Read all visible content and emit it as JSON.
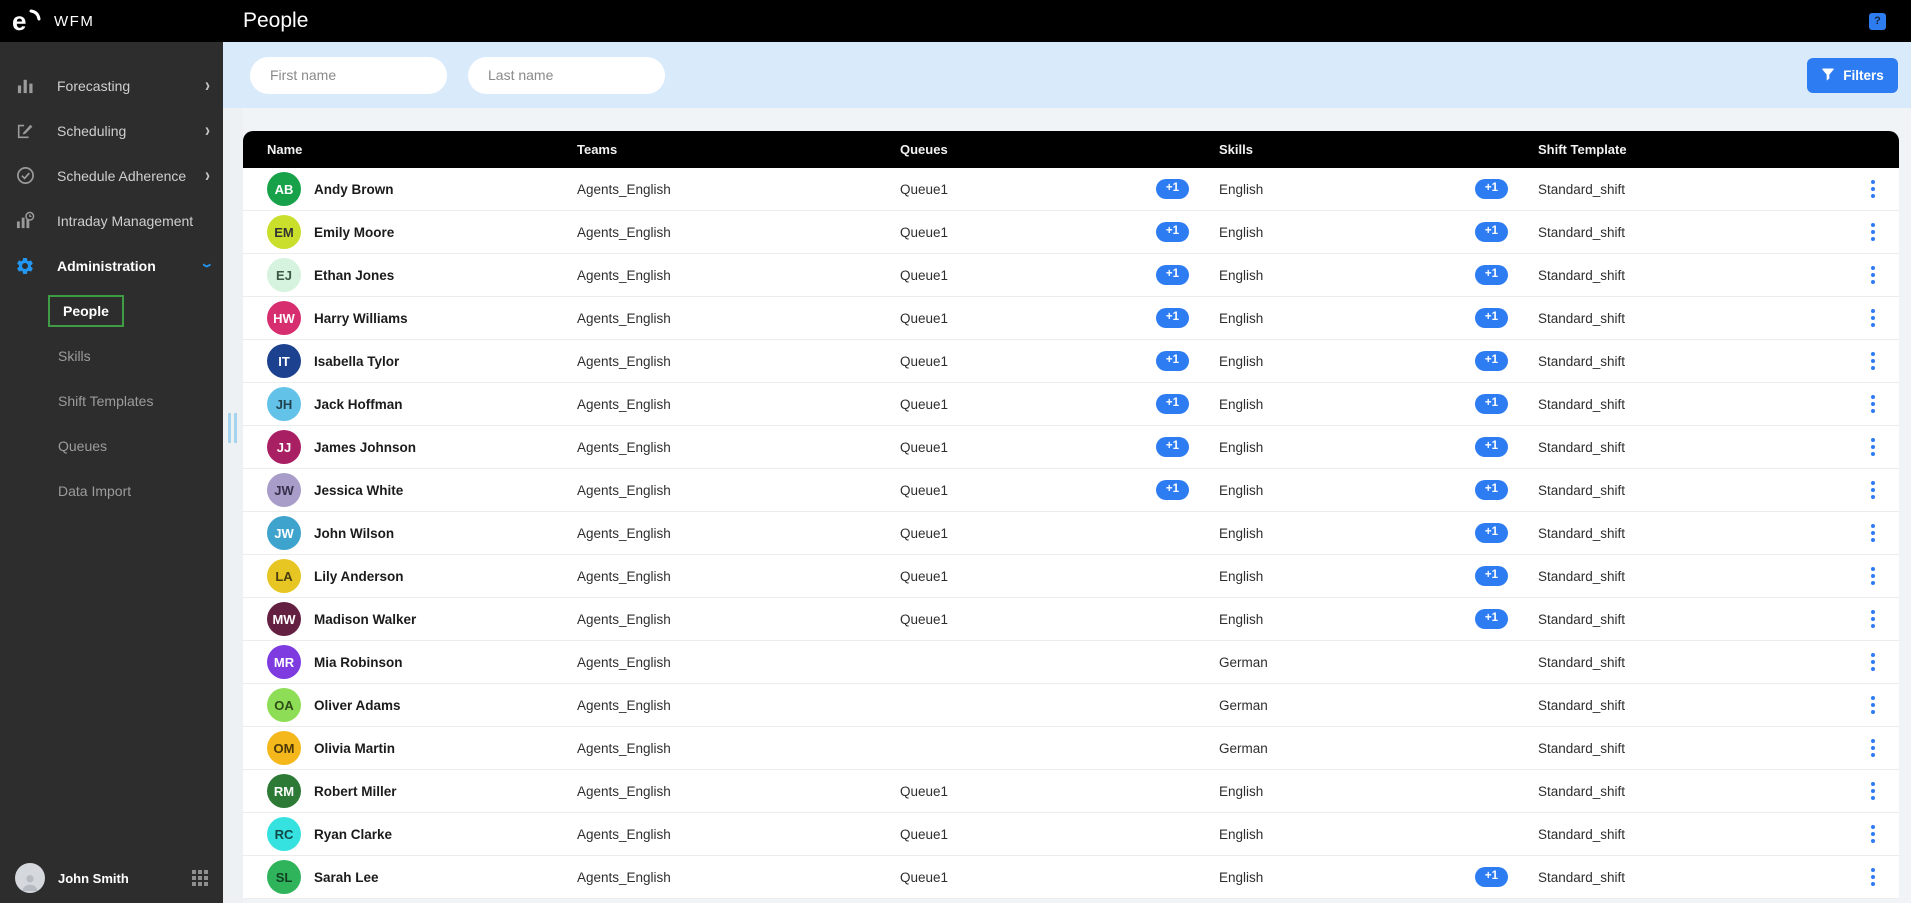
{
  "app": {
    "brand": "WFM",
    "page_title": "People",
    "help_label": "?"
  },
  "sidebar": {
    "items": [
      {
        "label": "Forecasting",
        "icon": "bar-chart-icon",
        "chevron": "right"
      },
      {
        "label": "Scheduling",
        "icon": "edit-icon",
        "chevron": "right"
      },
      {
        "label": "Schedule Adherence",
        "icon": "check-circle-icon",
        "chevron": "right"
      },
      {
        "label": "Intraday Management",
        "icon": "intraday-chart-icon",
        "chevron": ""
      },
      {
        "label": "Administration",
        "icon": "gear-icon",
        "chevron": "down",
        "active": true
      }
    ],
    "admin_children": [
      {
        "label": "People",
        "selected": true
      },
      {
        "label": "Skills",
        "selected": false
      },
      {
        "label": "Shift Templates",
        "selected": false
      },
      {
        "label": "Queues",
        "selected": false
      },
      {
        "label": "Data Import",
        "selected": false
      }
    ],
    "user": {
      "name": "John Smith"
    }
  },
  "filters": {
    "first_name_placeholder": "First name",
    "last_name_placeholder": "Last name",
    "filters_button_label": "Filters"
  },
  "colors": {
    "accent_blue": "#2e7cf2",
    "sidebar_selected_green": "#3f9c44",
    "filterbar_background": "#d9eafb",
    "table_header_background": "#000000",
    "gear_icon_blue": "#2196f3"
  },
  "table": {
    "columns": [
      "Name",
      "Teams",
      "Queues",
      "Skills",
      "Shift Template"
    ],
    "rows": [
      {
        "initials": "AB",
        "avatar_bg": "#17a24a",
        "avatar_fg": "#ffffff",
        "name": "Andy Brown",
        "team": "Agents_English",
        "queue": "Queue1",
        "queue_badge": "+1",
        "skill": "English",
        "skill_badge": "+1",
        "shift": "Standard_shift"
      },
      {
        "initials": "EM",
        "avatar_bg": "#c9df2b",
        "avatar_fg": "#333333",
        "name": "Emily Moore",
        "team": "Agents_English",
        "queue": "Queue1",
        "queue_badge": "+1",
        "skill": "English",
        "skill_badge": "+1",
        "shift": "Standard_shift"
      },
      {
        "initials": "EJ",
        "avatar_bg": "#d5f3de",
        "avatar_fg": "#3c5a44",
        "name": "Ethan Jones",
        "team": "Agents_English",
        "queue": "Queue1",
        "queue_badge": "+1",
        "skill": "English",
        "skill_badge": "+1",
        "shift": "Standard_shift"
      },
      {
        "initials": "HW",
        "avatar_bg": "#d62e6e",
        "avatar_fg": "#ffffff",
        "name": "Harry Williams",
        "team": "Agents_English",
        "queue": "Queue1",
        "queue_badge": "+1",
        "skill": "English",
        "skill_badge": "+1",
        "shift": "Standard_shift"
      },
      {
        "initials": "IT",
        "avatar_bg": "#1c418f",
        "avatar_fg": "#ffffff",
        "name": "Isabella Tylor",
        "team": "Agents_English",
        "queue": "Queue1",
        "queue_badge": "+1",
        "skill": "English",
        "skill_badge": "+1",
        "shift": "Standard_shift"
      },
      {
        "initials": "JH",
        "avatar_bg": "#63c2e8",
        "avatar_fg": "#21424f",
        "name": "Jack Hoffman",
        "team": "Agents_English",
        "queue": "Queue1",
        "queue_badge": "+1",
        "skill": "English",
        "skill_badge": "+1",
        "shift": "Standard_shift"
      },
      {
        "initials": "JJ",
        "avatar_bg": "#a81f63",
        "avatar_fg": "#ffffff",
        "name": "James Johnson",
        "team": "Agents_English",
        "queue": "Queue1",
        "queue_badge": "+1",
        "skill": "English",
        "skill_badge": "+1",
        "shift": "Standard_shift"
      },
      {
        "initials": "JW",
        "avatar_bg": "#a89dc9",
        "avatar_fg": "#35304a",
        "name": "Jessica White",
        "team": "Agents_English",
        "queue": "Queue1",
        "queue_badge": "+1",
        "skill": "English",
        "skill_badge": "+1",
        "shift": "Standard_shift"
      },
      {
        "initials": "JW",
        "avatar_bg": "#3ea3cd",
        "avatar_fg": "#ffffff",
        "name": "John Wilson",
        "team": "Agents_English",
        "queue": "Queue1",
        "queue_badge": "",
        "skill": "English",
        "skill_badge": "+1",
        "shift": "Standard_shift"
      },
      {
        "initials": "LA",
        "avatar_bg": "#e7c522",
        "avatar_fg": "#4a3e11",
        "name": "Lily Anderson",
        "team": "Agents_English",
        "queue": "Queue1",
        "queue_badge": "",
        "skill": "English",
        "skill_badge": "+1",
        "shift": "Standard_shift"
      },
      {
        "initials": "MW",
        "avatar_bg": "#632040",
        "avatar_fg": "#ffffff",
        "name": "Madison Walker",
        "team": "Agents_English",
        "queue": "Queue1",
        "queue_badge": "",
        "skill": "English",
        "skill_badge": "+1",
        "shift": "Standard_shift"
      },
      {
        "initials": "MR",
        "avatar_bg": "#7d3be0",
        "avatar_fg": "#ffffff",
        "name": "Mia Robinson",
        "team": "Agents_English",
        "queue": "",
        "queue_badge": "",
        "skill": "German",
        "skill_badge": "",
        "shift": "Standard_shift"
      },
      {
        "initials": "OA",
        "avatar_bg": "#8edd56",
        "avatar_fg": "#2f4c18",
        "name": "Oliver Adams",
        "team": "Agents_English",
        "queue": "",
        "queue_badge": "",
        "skill": "German",
        "skill_badge": "",
        "shift": "Standard_shift"
      },
      {
        "initials": "OM",
        "avatar_bg": "#f4b81d",
        "avatar_fg": "#4c390a",
        "name": "Olivia Martin",
        "team": "Agents_English",
        "queue": "",
        "queue_badge": "",
        "skill": "German",
        "skill_badge": "",
        "shift": "Standard_shift"
      },
      {
        "initials": "RM",
        "avatar_bg": "#2c7a36",
        "avatar_fg": "#ffffff",
        "name": "Robert Miller",
        "team": "Agents_English",
        "queue": "Queue1",
        "queue_badge": "",
        "skill": "English",
        "skill_badge": "",
        "shift": "Standard_shift"
      },
      {
        "initials": "RC",
        "avatar_bg": "#36e2df",
        "avatar_fg": "#124a49",
        "name": "Ryan Clarke",
        "team": "Agents_English",
        "queue": "Queue1",
        "queue_badge": "",
        "skill": "English",
        "skill_badge": "",
        "shift": "Standard_shift"
      },
      {
        "initials": "SL",
        "avatar_bg": "#2fb45c",
        "avatar_fg": "#123f22",
        "name": "Sarah Lee",
        "team": "Agents_English",
        "queue": "Queue1",
        "queue_badge": "",
        "skill": "English",
        "skill_badge": "+1",
        "shift": "Standard_shift"
      }
    ]
  }
}
